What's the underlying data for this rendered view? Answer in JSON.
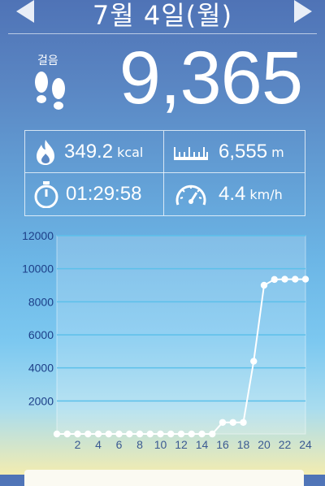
{
  "header": {
    "date": "7월 4일(월)",
    "prev_icon": "triangle-left-icon",
    "next_icon": "triangle-right-icon"
  },
  "steps": {
    "label": "걸음",
    "value": "9,365",
    "icon": "footprints-icon"
  },
  "stats": {
    "calories": {
      "value": "349.2",
      "unit": "kcal",
      "icon": "flame-icon"
    },
    "distance": {
      "value": "6,555",
      "unit": "m",
      "icon": "ruler-icon"
    },
    "time": {
      "value": "01:29:58",
      "icon": "stopwatch-icon"
    },
    "speed": {
      "value": "4.4",
      "unit": "km/h",
      "icon": "speedometer-icon"
    }
  },
  "chart_data": {
    "type": "line",
    "title": "",
    "xlabel": "",
    "ylabel": "",
    "ylim": [
      0,
      12000
    ],
    "xlim": [
      0,
      24
    ],
    "y_ticks": [
      2000,
      4000,
      6000,
      8000,
      10000,
      12000
    ],
    "x_ticks": [
      2,
      4,
      6,
      8,
      10,
      12,
      14,
      16,
      18,
      20,
      22,
      24
    ],
    "grid": true,
    "x": [
      0,
      1,
      2,
      3,
      4,
      5,
      6,
      7,
      8,
      9,
      10,
      11,
      12,
      13,
      14,
      15,
      16,
      17,
      18,
      19,
      20,
      21,
      22,
      23,
      24
    ],
    "values": [
      0,
      0,
      0,
      0,
      0,
      0,
      0,
      0,
      0,
      0,
      0,
      0,
      0,
      0,
      0,
      0,
      700,
      700,
      700,
      4400,
      9000,
      9350,
      9365,
      9365,
      9365
    ]
  },
  "colors": {
    "line": "#ffffff",
    "ylabel": "#1d3f88",
    "xlabel": "#3b5a92",
    "grid": "#5cc0ea"
  }
}
